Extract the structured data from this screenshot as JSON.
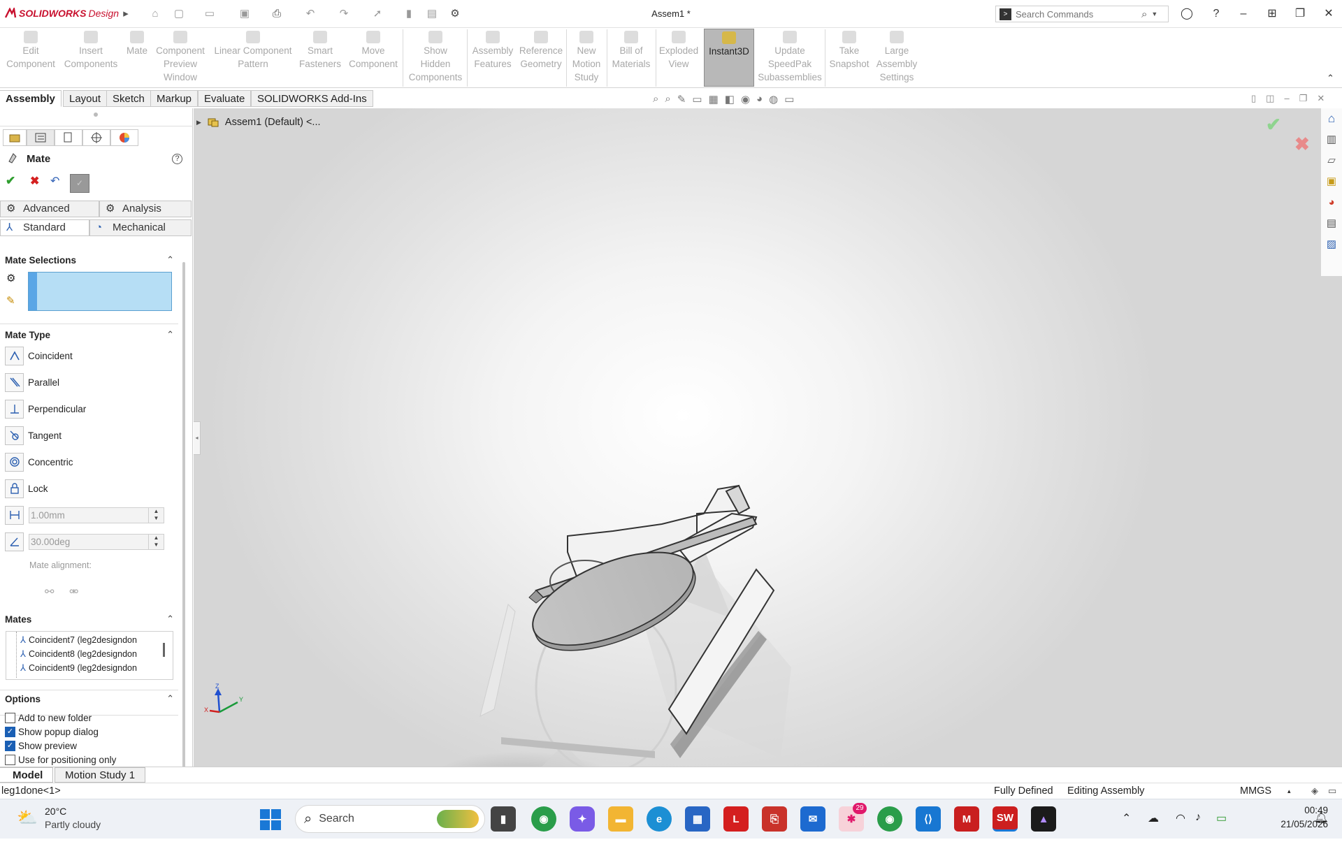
{
  "app": {
    "brand_ds": "3DS",
    "brand_name": "SOLIDWORKS",
    "brand_suffix": "Design",
    "document_title": "Assem1 *"
  },
  "search": {
    "placeholder": "Search Commands"
  },
  "ribbon": {
    "commands": [
      {
        "label": "Edit\nComponent",
        "icon": "edit-component-icon"
      },
      {
        "label": "Insert\nComponents",
        "icon": "insert-components-icon"
      },
      {
        "label": "Mate",
        "icon": "mate-icon"
      },
      {
        "label": "Component\nPreview\nWindow",
        "icon": "preview-window-icon"
      },
      {
        "label": "Linear Component\nPattern",
        "icon": "pattern-icon"
      },
      {
        "label": "Smart\nFasteners",
        "icon": "fasteners-icon"
      },
      {
        "label": "Move\nComponent",
        "icon": "move-component-icon"
      },
      {
        "label": "Show\nHidden\nComponents",
        "icon": "show-hidden-icon"
      },
      {
        "label": "Assembly\nFeatures",
        "icon": "assembly-features-icon"
      },
      {
        "label": "Reference\nGeometry",
        "icon": "reference-geometry-icon"
      },
      {
        "label": "New\nMotion\nStudy",
        "icon": "motion-study-icon"
      },
      {
        "label": "Bill of\nMaterials",
        "icon": "bom-icon"
      },
      {
        "label": "Exploded\nView",
        "icon": "exploded-view-icon"
      },
      {
        "label": "Instant3D",
        "icon": "instant3d-icon"
      },
      {
        "label": "Update\nSpeedPak\nSubassemblies",
        "icon": "speedpak-icon"
      },
      {
        "label": "Take\nSnapshot",
        "icon": "snapshot-icon"
      },
      {
        "label": "Large\nAssembly\nSettings",
        "icon": "large-assembly-icon"
      }
    ]
  },
  "tabs": [
    "Assembly",
    "Layout",
    "Sketch",
    "Markup",
    "Evaluate",
    "SOLIDWORKS Add-Ins"
  ],
  "feature_tree": {
    "root": "Assem1 (Default) <..."
  },
  "mate_panel": {
    "title": "Mate",
    "tabs": {
      "advanced": "Advanced",
      "analysis": "Analysis",
      "standard": "Standard",
      "mechanical": "Mechanical"
    },
    "mate_selections": "Mate Selections",
    "mate_type": "Mate Type",
    "types": [
      "Coincident",
      "Parallel",
      "Perpendicular",
      "Tangent",
      "Concentric",
      "Lock"
    ],
    "distance_value": "1.00mm",
    "angle_value": "30.00deg",
    "mate_alignment": "Mate alignment:",
    "mates_header": "Mates",
    "mates": [
      "Coincident7 (leg2designdon",
      "Coincident8 (leg2designdon",
      "Coincident9 (leg2designdon"
    ],
    "options_header": "Options",
    "options": [
      {
        "label": "Add to new folder",
        "checked": false
      },
      {
        "label": "Show popup dialog",
        "checked": true
      },
      {
        "label": "Show preview",
        "checked": true
      },
      {
        "label": "Use for positioning only",
        "checked": false
      }
    ]
  },
  "bottom_tabs": [
    "Model",
    "Motion Study 1"
  ],
  "status": {
    "selection": "leg1done<1>",
    "defined": "Fully Defined",
    "mode": "Editing Assembly",
    "units": "MMGS"
  },
  "taskbar": {
    "weather_temp": "20°C",
    "weather_text": "Partly cloudy",
    "search_label": "Search",
    "time": "00:49",
    "date": "21/05/2026",
    "notification_badge": "29"
  },
  "triad": {
    "z": "Z",
    "x": "X",
    "y": "Y"
  },
  "colors": {
    "accent": "#1a5fb4",
    "brand": "#c8102e",
    "selection_box": "#b6def5"
  }
}
